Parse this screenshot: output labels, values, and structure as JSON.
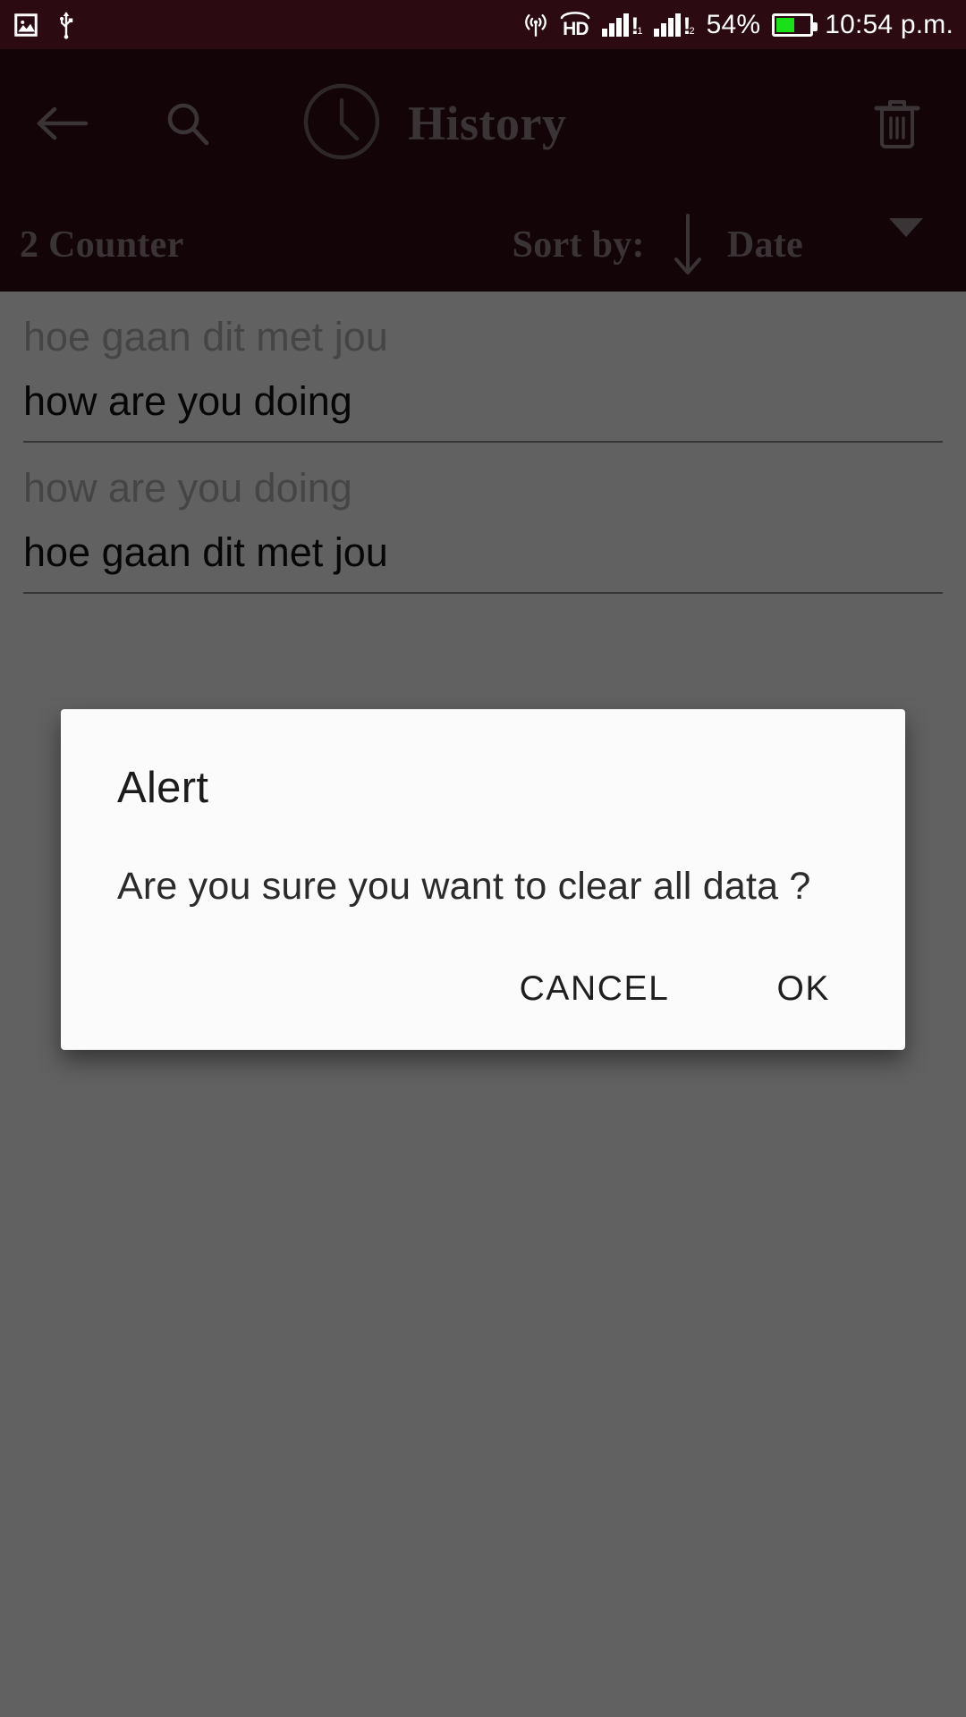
{
  "statusbar": {
    "left_icons": [
      {
        "name": "image-icon",
        "label": "image"
      },
      {
        "name": "usb-icon",
        "label": "usb"
      }
    ],
    "right_icons": [
      {
        "name": "hotspot-icon",
        "label": "hotspot"
      },
      {
        "name": "hd-voice-icon",
        "label": "HD"
      },
      {
        "name": "signal-sim1-icon",
        "label": "signal sim 1"
      },
      {
        "name": "signal-sim2-icon",
        "label": "signal sim 2"
      }
    ],
    "hd_label": "HD",
    "sim1_index": "1",
    "sim2_index": "2",
    "signal_alert": "!",
    "battery_percent_label": "54%",
    "battery_level": 54,
    "time": "10:54 p.m."
  },
  "titlebar": {
    "back_label": "Back",
    "search_label": "Search",
    "clock_icon": "clock-icon",
    "title": "History",
    "delete_label": "Clear history"
  },
  "sortbar": {
    "counter": "2 Counter",
    "sort_by_label": "Sort by:",
    "sort_direction": "descending",
    "sort_field": "Date",
    "dropdown_icon": "chevron-down-icon"
  },
  "history": {
    "items": [
      {
        "source": "hoe gaan dit met jou",
        "target": "how are you doing"
      },
      {
        "source": "how are you doing",
        "target": "hoe gaan dit met jou"
      }
    ]
  },
  "dialog": {
    "title": "Alert",
    "message": "Are you sure you want to clear all data ?",
    "cancel_label": "CANCEL",
    "ok_label": "OK"
  },
  "colors": {
    "header": "#340b16",
    "statusbar": "#2b0a12",
    "header_text": "#9a8a8e",
    "battery_green": "#19e019",
    "dialog_bg": "#fbfbfb",
    "scrim": "rgba(0,0,0,0.62)"
  }
}
